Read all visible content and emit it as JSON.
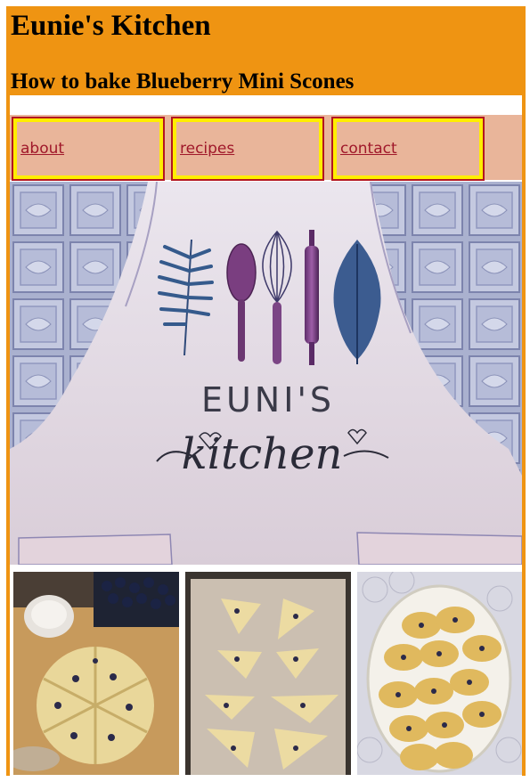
{
  "header": {
    "site_title": "Eunie's Kitchen",
    "page_title": "How to bake Blueberry Mini Scones"
  },
  "nav": {
    "items": [
      {
        "label": "about"
      },
      {
        "label": "recipes"
      },
      {
        "label": "contact"
      }
    ]
  },
  "hero": {
    "image": "apron-photo",
    "apron_text_top": "EUNI'S",
    "apron_text_bottom": "kitchen"
  },
  "gallery": {
    "images": [
      "scone-dough-photo",
      "scones-on-tray-photo",
      "baked-scones-bowl-photo"
    ]
  },
  "colors": {
    "header_bg": "#ef9412",
    "nav_bg": "#e9b59a",
    "nav_border": "#b31620",
    "nav_outline": "#ffee00",
    "link": "#a0182a"
  }
}
